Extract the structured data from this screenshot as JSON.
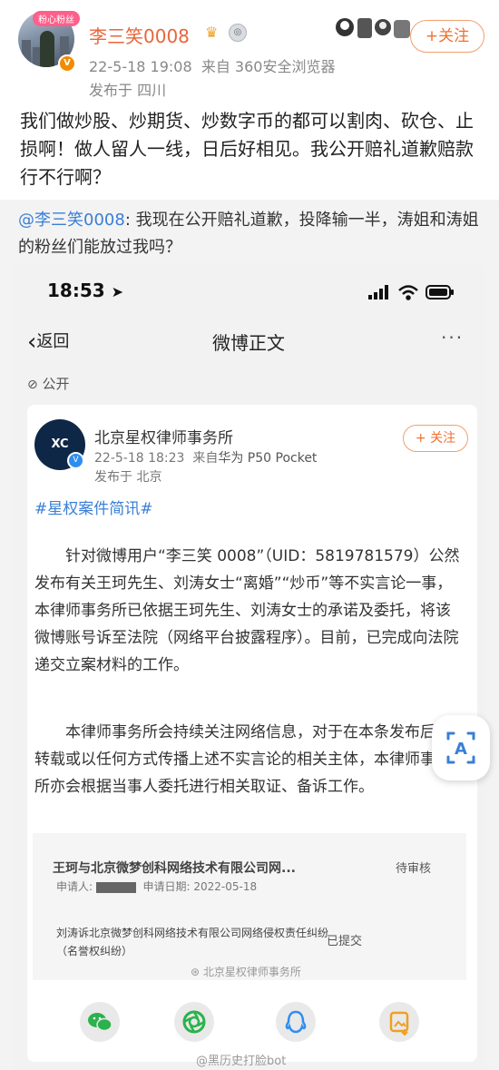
{
  "post": {
    "badge": "粉心粉丝",
    "username": "李三笑0008",
    "time": "22-5-18 19:08",
    "source": "来自 360安全浏览器",
    "location": "发布于 四川",
    "follow_label": "+关注",
    "text": "我们做炒股、炒期货、炒数字币的都可以割肉、砍仓、止损啊！做人留人一线，日后好相见。我公开赔礼道歉赔款行不行啊？"
  },
  "repost": {
    "mention": "@李三笑0008",
    "text": ": 我现在公开赔礼道歉，投降输一半，涛姐和涛姐的粉丝们能放过我吗？"
  },
  "screenshot": {
    "status_time": "18:53",
    "nav": {
      "back": "返回",
      "title": "微博正文",
      "more": "···"
    },
    "visibility": "公开",
    "lawyer": {
      "avatar_text": "XC",
      "name": "北京星权律师事务所",
      "time": "22-5-18 18:23",
      "source_prefix": "来自",
      "device": "华为 P50 Pocket",
      "location": "发布于 北京",
      "follow_label": "+ 关注"
    },
    "topic": "#星权案件简讯#",
    "paragraph1": "针对微博用户“李三笑 0008”（UID：5819781579）公然发布有关王珂先生、刘涛女士“离婚”“炒币”等不实言论一事，本律师事务所已依据王珂先生、刘涛女士的承诺及委托，将该微博账号诉至法院（网络平台披露程序）。目前，已完成向法院递交立案材料的工作。",
    "paragraph2": "本律师事务所会持续关注网络信息，对于在本条发布后仍转载或以任何方式传播上述不实言论的相关主体，本律师事务所亦会根据当事人委托进行相关取证、备诉工作。",
    "cases": [
      {
        "title": "王珂与北京微梦创科网络技术有限公司网...",
        "status": "待审核",
        "applicant_label": "申请人:",
        "date_label": "申请日期: 2022-05-18"
      },
      {
        "title": "刘涛诉北京微梦创科网络技术有限公司网络侵权责任纠纷（名誉权纠纷）",
        "status": "已提交"
      }
    ],
    "image_watermark": "北京星权律师事务所",
    "share_icons": [
      "wechat-icon",
      "moments-icon",
      "qq-icon",
      "save-image-icon"
    ]
  },
  "watermark": "@黑历史打脸bot",
  "colors": {
    "accent_orange": "#f07030",
    "link_blue": "#3a7fd5",
    "username_orange": "#e8663b"
  }
}
